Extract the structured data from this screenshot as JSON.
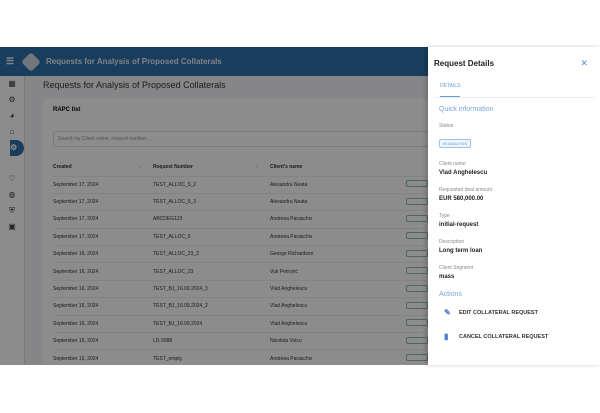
{
  "app": {
    "title": "Requests for Analysis of Proposed Collaterals",
    "page_title": "Requests for Analysis of Proposed Collaterals",
    "card_title": "RAPC list",
    "search_placeholder": "Search by Client name, request number...",
    "sidebar_icons": [
      "dashboard-icon",
      "gear-icon",
      "pie-chart-icon",
      "bank-icon",
      "collateral-icon",
      "handshake-icon",
      "globe-icon",
      "shield-icon",
      "person-badge-icon"
    ],
    "columns": [
      "Created",
      "Request Number",
      "Client's name"
    ],
    "rows": [
      [
        "September 17, 2024",
        "TEST_ALLOC_5_2",
        "Alexandru Neata"
      ],
      [
        "September 17, 2024",
        "TEST_ALLOC_5_3",
        "Alexandru Neata"
      ],
      [
        "September 17, 2024",
        "ABCDEG123",
        "Andreea Paraschiv"
      ],
      [
        "September 17, 2024",
        "TEST_ALLOC_5",
        "Andreea Paraschiv"
      ],
      [
        "September 16, 2024",
        "TEST_ALLOC_23_2",
        "George Richardson"
      ],
      [
        "September 16, 2024",
        "TEST_ALLOC_23",
        "Vuk Petrović"
      ],
      [
        "September 16, 2024",
        "TEST_BJ_16.09.2024_3",
        "Vlad Anghelescu"
      ],
      [
        "September 16, 2024",
        "TEST_BJ_16.09.2024_2",
        "Vlad Anghelescu"
      ],
      [
        "September 16, 2024",
        "TEST_BJ_16.09.2024",
        "Vlad Anghelescu"
      ],
      [
        "September 15, 2024",
        "LD-3988",
        "Nicoleta Voicu"
      ],
      [
        "September 13, 2024",
        "TEST_empty",
        "Andreea Paraschiv"
      ]
    ]
  },
  "panel": {
    "title": "Request Details",
    "tab": "DETAILS",
    "quick_info": "Quick information",
    "fields": [
      {
        "label": "Client name",
        "value": "Vlad Anghelescu"
      },
      {
        "label": "Requested deal amount",
        "value": "EUR 580,000.00"
      },
      {
        "label": "Type",
        "value": "initial-request"
      },
      {
        "label": "Description",
        "value": "Long term loan"
      },
      {
        "label": "Client Segment",
        "value": "mass"
      }
    ],
    "status_label": "Status",
    "status": "IN ANALYSIS",
    "actions_title": "Actions",
    "actions": [
      "EDIT COLLATERAL REQUEST",
      "CANCEL COLLATERAL REQUEST"
    ]
  }
}
